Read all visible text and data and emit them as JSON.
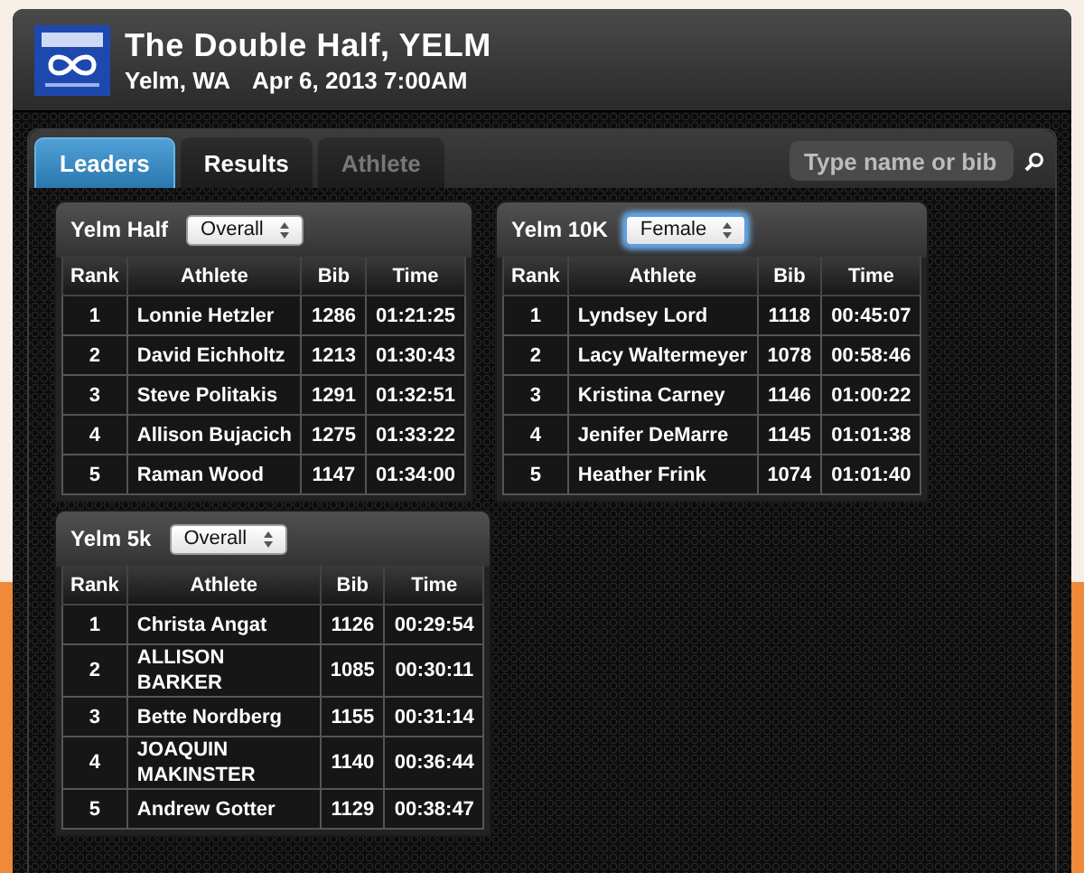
{
  "header": {
    "title": "The Double Half, YELM",
    "location": "Yelm, WA",
    "date": "Apr 6, 2013 7:00AM"
  },
  "tabs": [
    {
      "label": "Leaders",
      "selected": true,
      "disabled": false
    },
    {
      "label": "Results",
      "selected": false,
      "disabled": false
    },
    {
      "label": "Athlete",
      "selected": false,
      "disabled": true
    }
  ],
  "search": {
    "placeholder": "Type name or bib"
  },
  "panels": [
    {
      "title": "Yelm Half",
      "filter": {
        "value": "Overall",
        "focused": false
      },
      "columns": [
        "Rank",
        "Athlete",
        "Bib",
        "Time"
      ],
      "rows": [
        [
          "1",
          "Lonnie Hetzler",
          "1286",
          "01:21:25"
        ],
        [
          "2",
          "David Eichholtz",
          "1213",
          "01:30:43"
        ],
        [
          "3",
          "Steve Politakis",
          "1291",
          "01:32:51"
        ],
        [
          "4",
          "Allison Bujacich",
          "1275",
          "01:33:22"
        ],
        [
          "5",
          "Raman Wood",
          "1147",
          "01:34:00"
        ]
      ]
    },
    {
      "title": "Yelm 10K",
      "filter": {
        "value": "Female",
        "focused": true
      },
      "columns": [
        "Rank",
        "Athlete",
        "Bib",
        "Time"
      ],
      "rows": [
        [
          "1",
          "Lyndsey Lord",
          "1118",
          "00:45:07"
        ],
        [
          "2",
          "Lacy Waltermeyer",
          "1078",
          "00:58:46"
        ],
        [
          "3",
          "Kristina Carney",
          "1146",
          "01:00:22"
        ],
        [
          "4",
          "Jenifer DeMarre",
          "1145",
          "01:01:38"
        ],
        [
          "5",
          "Heather Frink",
          "1074",
          "01:01:40"
        ]
      ]
    },
    {
      "title": "Yelm 5k",
      "filter": {
        "value": "Overall",
        "focused": false
      },
      "columns": [
        "Rank",
        "Athlete",
        "Bib",
        "Time"
      ],
      "rows": [
        [
          "1",
          "Christa Angat",
          "1126",
          "00:29:54"
        ],
        [
          "2",
          "ALLISON BARKER",
          "1085",
          "00:30:11"
        ],
        [
          "3",
          "Bette Nordberg",
          "1155",
          "00:31:14"
        ],
        [
          "4",
          "JOAQUIN MAKINSTER",
          "1140",
          "00:36:44"
        ],
        [
          "5",
          "Andrew Gotter",
          "1129",
          "00:38:47"
        ]
      ]
    }
  ]
}
